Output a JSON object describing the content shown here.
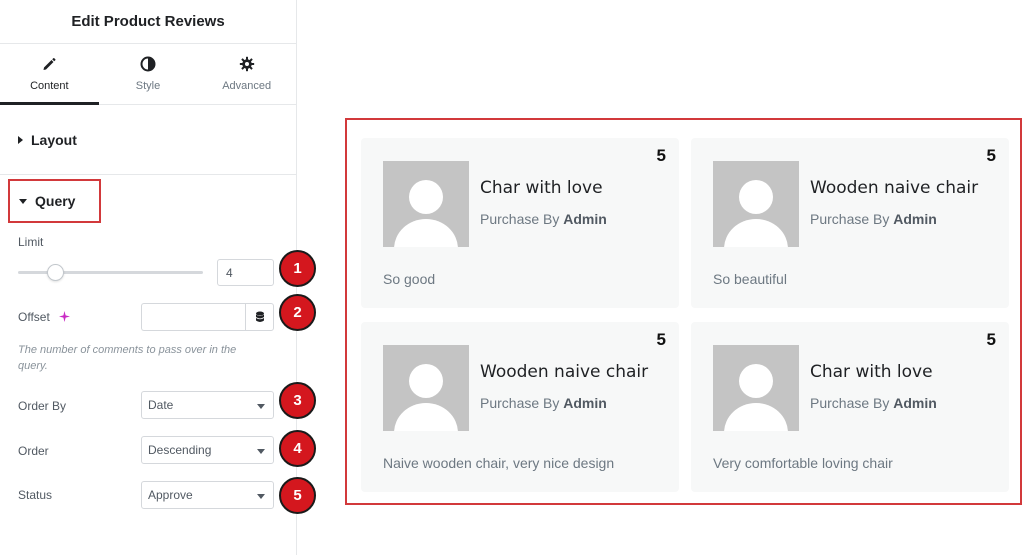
{
  "panel": {
    "title": "Edit Product Reviews",
    "tabs": [
      {
        "label": "Content",
        "icon": "pencil-icon",
        "active": true
      },
      {
        "label": "Style",
        "icon": "half-circle-icon",
        "active": false
      },
      {
        "label": "Advanced",
        "icon": "gear-icon",
        "active": false
      }
    ],
    "sections": {
      "layout": "Layout",
      "query": "Query"
    },
    "controls": {
      "limit": {
        "label": "Limit",
        "value": "4",
        "slider_fraction": 0.2
      },
      "offset": {
        "label": "Offset",
        "value": "",
        "help": "The number of comments to pass over in the query."
      },
      "order_by": {
        "label": "Order By",
        "value": "Date"
      },
      "order": {
        "label": "Order",
        "value": "Descending"
      },
      "status": {
        "label": "Status",
        "value": "Approve"
      }
    },
    "badges": [
      "1",
      "2",
      "3",
      "4",
      "5"
    ]
  },
  "colors": {
    "highlight": "#d2393b",
    "badge": "#d4171e"
  },
  "reviews": [
    {
      "title": "Char with love",
      "by_prefix": "Purchase By",
      "author": "Admin",
      "rating": "5",
      "body": "So good"
    },
    {
      "title": "Wooden naive chair",
      "by_prefix": "Purchase By",
      "author": "Admin",
      "rating": "5",
      "body": "So beautiful"
    },
    {
      "title": "Wooden naive chair",
      "by_prefix": "Purchase By",
      "author": "Admin",
      "rating": "5",
      "body": "Naive wooden chair, very nice design"
    },
    {
      "title": "Char with love",
      "by_prefix": "Purchase By",
      "author": "Admin",
      "rating": "5",
      "body": "Very comfortable loving chair"
    }
  ]
}
